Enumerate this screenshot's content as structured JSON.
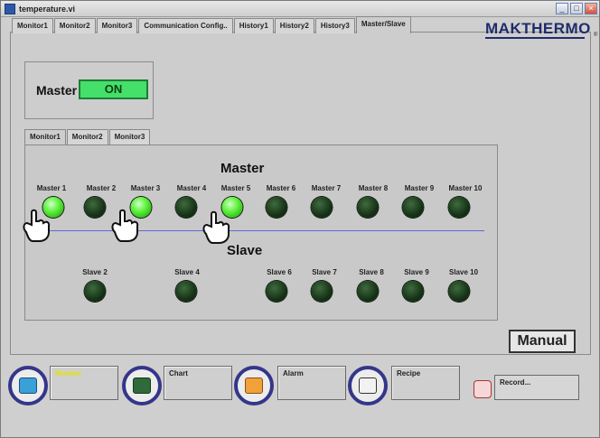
{
  "window": {
    "title": "temperature.vi"
  },
  "tabs": [
    "Monitor1",
    "Monitor2",
    "Monitor3",
    "Communication Config..",
    "History1",
    "History2",
    "History3",
    "Master/Slave"
  ],
  "active_tab": "Master/Slave",
  "logo": {
    "text": "MAKTHERMO",
    "reg": "®"
  },
  "master_control": {
    "label": "Master",
    "state": "ON"
  },
  "subtabs": [
    "Monitor1",
    "Monitor2",
    "Monitor3"
  ],
  "active_subtab": "Monitor1",
  "master_section": {
    "title": "Master",
    "units": [
      {
        "label": "Master 1",
        "on": true
      },
      {
        "label": "Master 2",
        "on": false
      },
      {
        "label": "Master 3",
        "on": true
      },
      {
        "label": "Master 4",
        "on": false
      },
      {
        "label": "Master 5",
        "on": true
      },
      {
        "label": "Master 6",
        "on": false
      },
      {
        "label": "Master 7",
        "on": false
      },
      {
        "label": "Master 8",
        "on": false
      },
      {
        "label": "Master 9",
        "on": false
      },
      {
        "label": "Master 10",
        "on": false
      }
    ]
  },
  "slave_section": {
    "title": "Slave",
    "units": [
      {
        "label": "Slave 2",
        "on": false
      },
      {
        "label": "Slave 4",
        "on": false
      },
      {
        "label": "Slave 6",
        "on": false
      },
      {
        "label": "Slave 7",
        "on": false
      },
      {
        "label": "Slave 8",
        "on": false
      },
      {
        "label": "Slave 9",
        "on": false
      },
      {
        "label": "Slave 10",
        "on": false
      }
    ]
  },
  "manual_button": "Manual",
  "bottom_nav": [
    {
      "label": "Monitor",
      "icon": "monitor-icon"
    },
    {
      "label": "Chart",
      "icon": "chart-icon"
    },
    {
      "label": "Alarm",
      "icon": "alarm-icon"
    },
    {
      "label": "Recipe",
      "icon": "recipe-icon"
    }
  ],
  "record_button": "Record...",
  "colors": {
    "led_on": "#57ef35",
    "led_off": "#173317",
    "master_on_bg": "#44e06a",
    "divider": "#5c69d8",
    "nav_ring": "#34368a",
    "monitor_label": "#e4e400"
  }
}
